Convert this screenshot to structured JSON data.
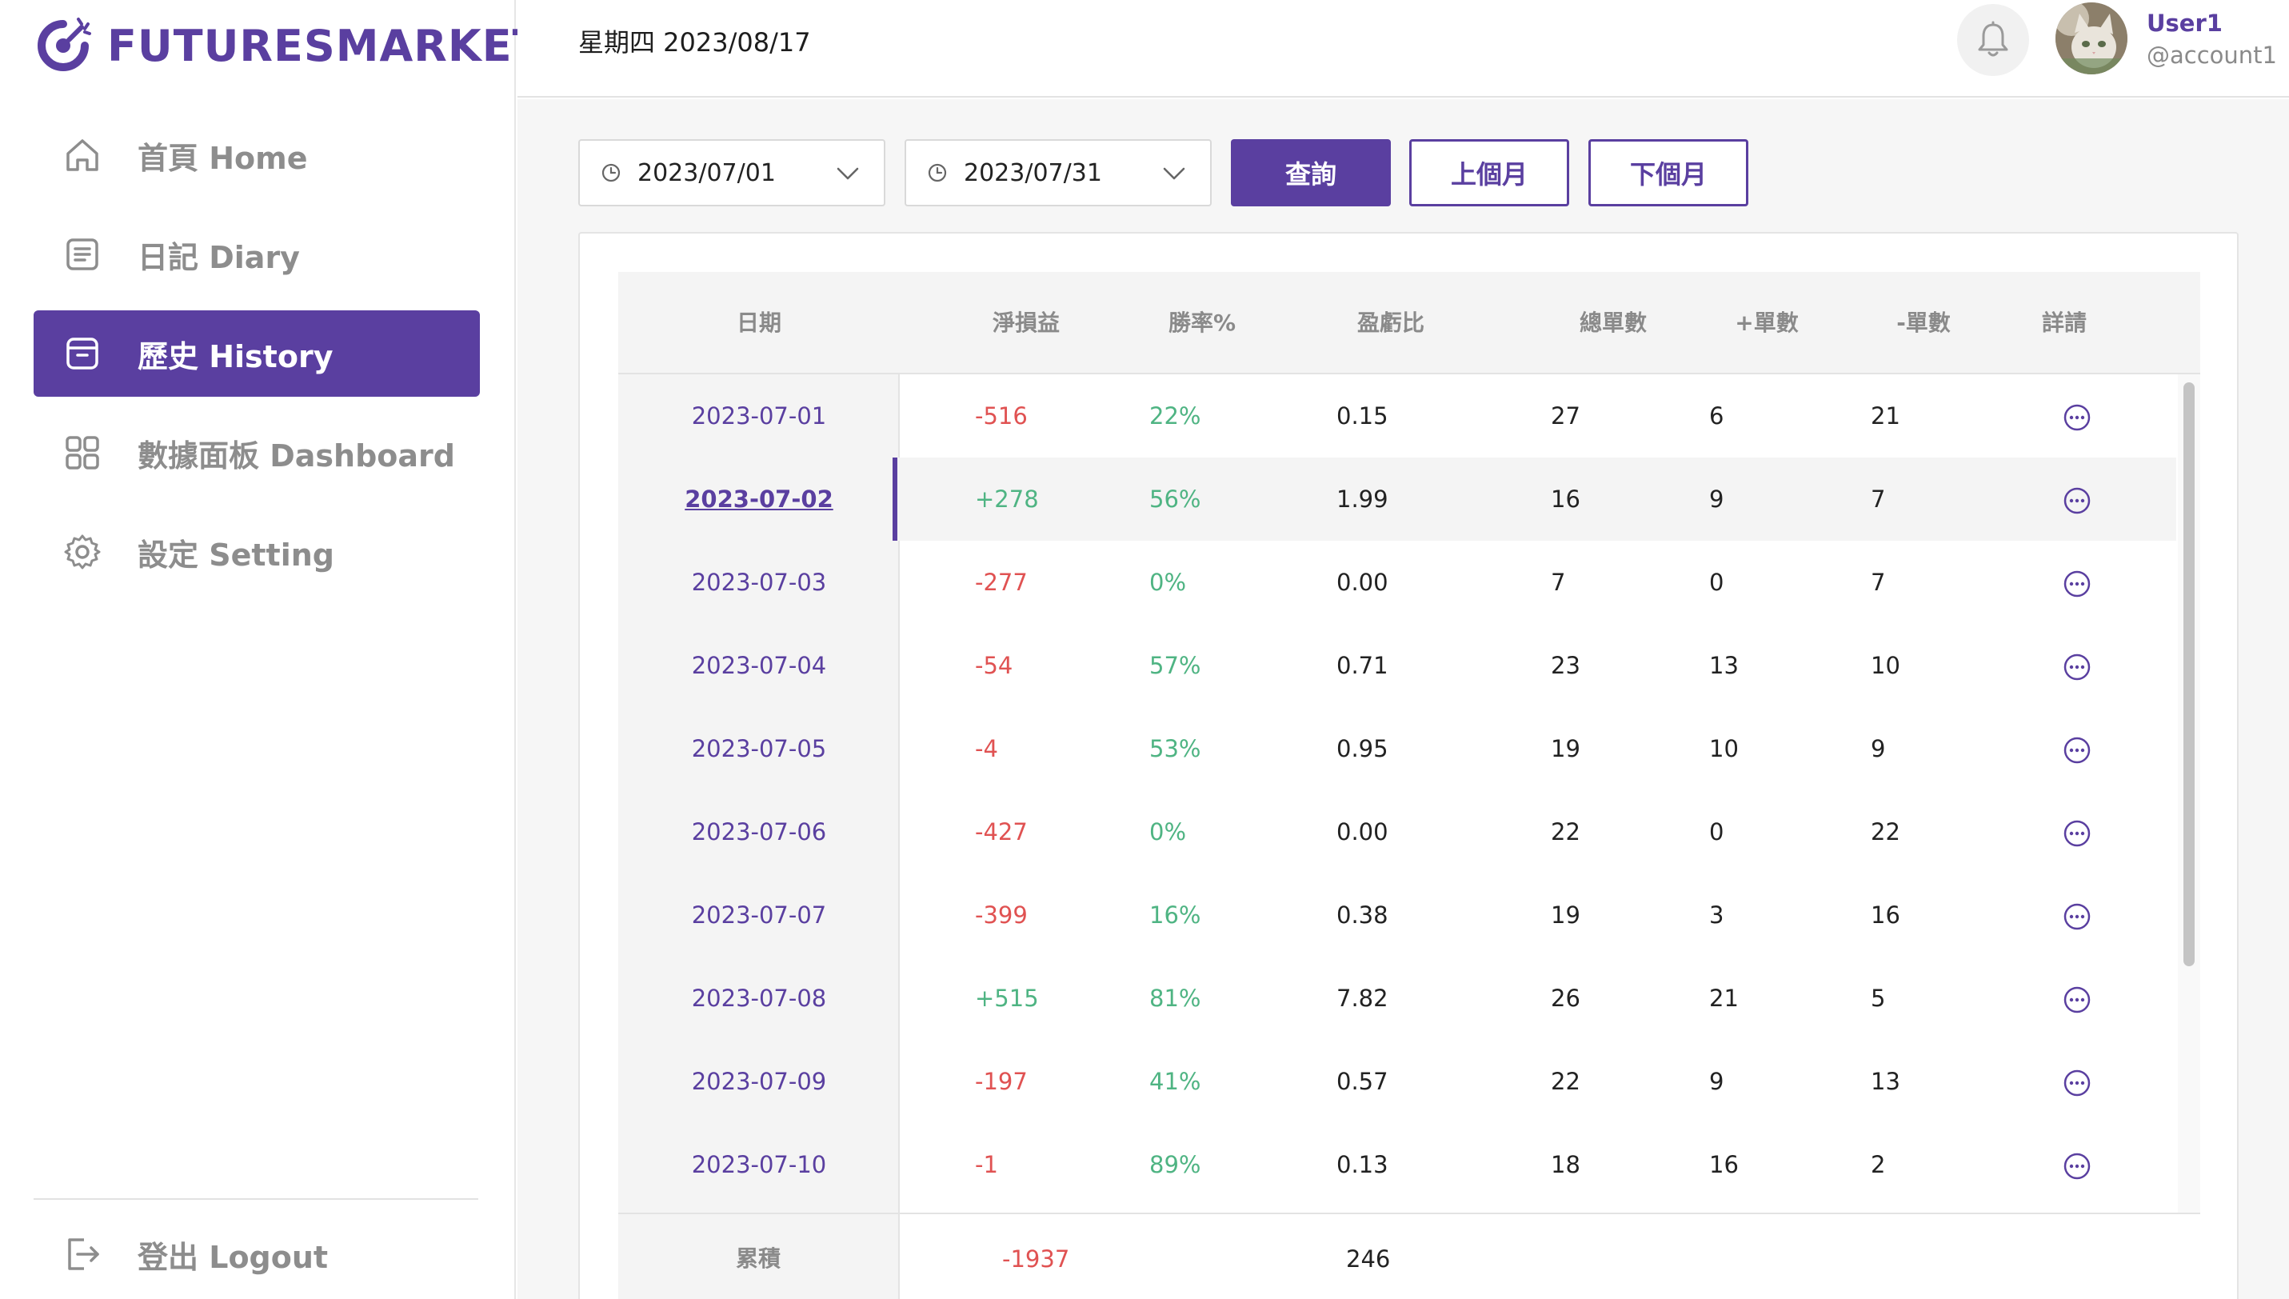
{
  "brand": {
    "name": "FUTURESMARKET",
    "color": "#5a3fa0"
  },
  "nav": {
    "items": [
      {
        "id": "home",
        "label": "首頁  Home",
        "icon": "home-icon"
      },
      {
        "id": "diary",
        "label": "日記  Diary",
        "icon": "diary-icon"
      },
      {
        "id": "history",
        "label": "歷史  History",
        "icon": "archive-icon",
        "active": true
      },
      {
        "id": "dashboard",
        "label": "數據面板  Dashboard",
        "icon": "grid-icon"
      },
      {
        "id": "setting",
        "label": "設定  Setting",
        "icon": "gear-icon"
      }
    ],
    "logout": {
      "label": "登出  Logout",
      "icon": "logout-icon"
    }
  },
  "header": {
    "date": "星期四  2023/08/17",
    "user": {
      "name": "User1",
      "account": "@account1"
    }
  },
  "filters": {
    "start_date": "2023/07/01",
    "end_date": "2023/07/31",
    "query_label": "查詢",
    "prev_month_label": "上個月",
    "next_month_label": "下個月"
  },
  "table": {
    "headers": {
      "date": "日期",
      "net_pnl": "淨損益",
      "win_rate": "勝率%",
      "profit_ratio": "盈虧比",
      "total": "總單數",
      "plus": "+單數",
      "minus": "-單數",
      "detail": "詳請"
    },
    "rows": [
      {
        "date": "2023-07-01",
        "net_pnl": "-516",
        "win_rate": "22%",
        "profit_ratio": "0.15",
        "total": "27",
        "plus": "6",
        "minus": "21"
      },
      {
        "date": "2023-07-02",
        "net_pnl": "+278",
        "win_rate": "56%",
        "profit_ratio": "1.99",
        "total": "16",
        "plus": "9",
        "minus": "7",
        "selected": true
      },
      {
        "date": "2023-07-03",
        "net_pnl": "-277",
        "win_rate": "0%",
        "profit_ratio": "0.00",
        "total": "7",
        "plus": "0",
        "minus": "7"
      },
      {
        "date": "2023-07-04",
        "net_pnl": "-54",
        "win_rate": "57%",
        "profit_ratio": "0.71",
        "total": "23",
        "plus": "13",
        "minus": "10"
      },
      {
        "date": "2023-07-05",
        "net_pnl": "-4",
        "win_rate": "53%",
        "profit_ratio": "0.95",
        "total": "19",
        "plus": "10",
        "minus": "9"
      },
      {
        "date": "2023-07-06",
        "net_pnl": "-427",
        "win_rate": "0%",
        "profit_ratio": "0.00",
        "total": "22",
        "plus": "0",
        "minus": "22"
      },
      {
        "date": "2023-07-07",
        "net_pnl": "-399",
        "win_rate": "16%",
        "profit_ratio": "0.38",
        "total": "19",
        "plus": "3",
        "minus": "16"
      },
      {
        "date": "2023-07-08",
        "net_pnl": "+515",
        "win_rate": "81%",
        "profit_ratio": "7.82",
        "total": "26",
        "plus": "21",
        "minus": "5"
      },
      {
        "date": "2023-07-09",
        "net_pnl": "-197",
        "win_rate": "41%",
        "profit_ratio": "0.57",
        "total": "22",
        "plus": "9",
        "minus": "13"
      },
      {
        "date": "2023-07-10",
        "net_pnl": "-1",
        "win_rate": "89%",
        "profit_ratio": "0.13",
        "total": "18",
        "plus": "16",
        "minus": "2"
      }
    ],
    "footer": {
      "label": "累積",
      "net_pnl": "-1937",
      "total": "246"
    }
  },
  "colors": {
    "accent": "#5a3fa0",
    "negative": "#e05252",
    "positive": "#4fb483"
  }
}
